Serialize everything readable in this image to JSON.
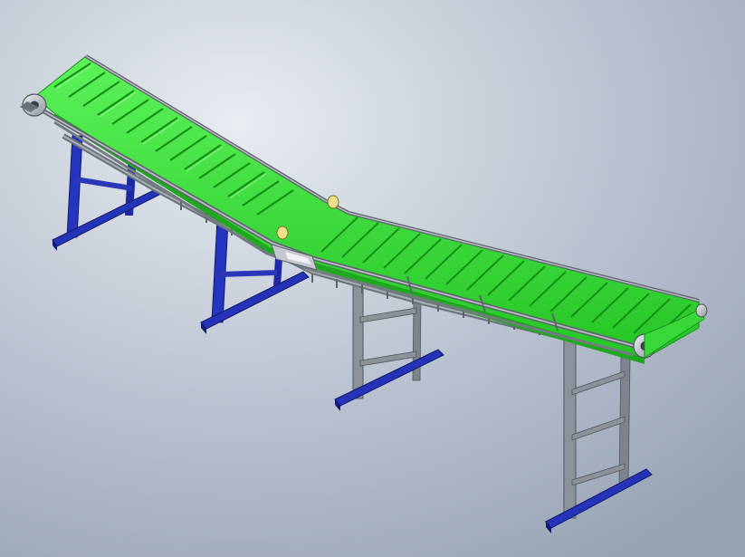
{
  "scene": {
    "subject": "inclined-belt-conveyor",
    "colors": {
      "background_light": "#e9ecf1",
      "background_mid": "#bcc5d2",
      "background_dark": "#96a2b4",
      "belt": "#3ee83e",
      "belt_shade": "#21b521",
      "belt_highlight": "#a9ff9d",
      "cleat": "#1e9a1e",
      "frame_steel": "#8b9299",
      "frame_dark": "#4f565d",
      "base_blue": "#2433b8",
      "base_blue_dark": "#121c78",
      "bearing_yellow": "#efe08a",
      "pulley": "#c5c9cf"
    }
  }
}
